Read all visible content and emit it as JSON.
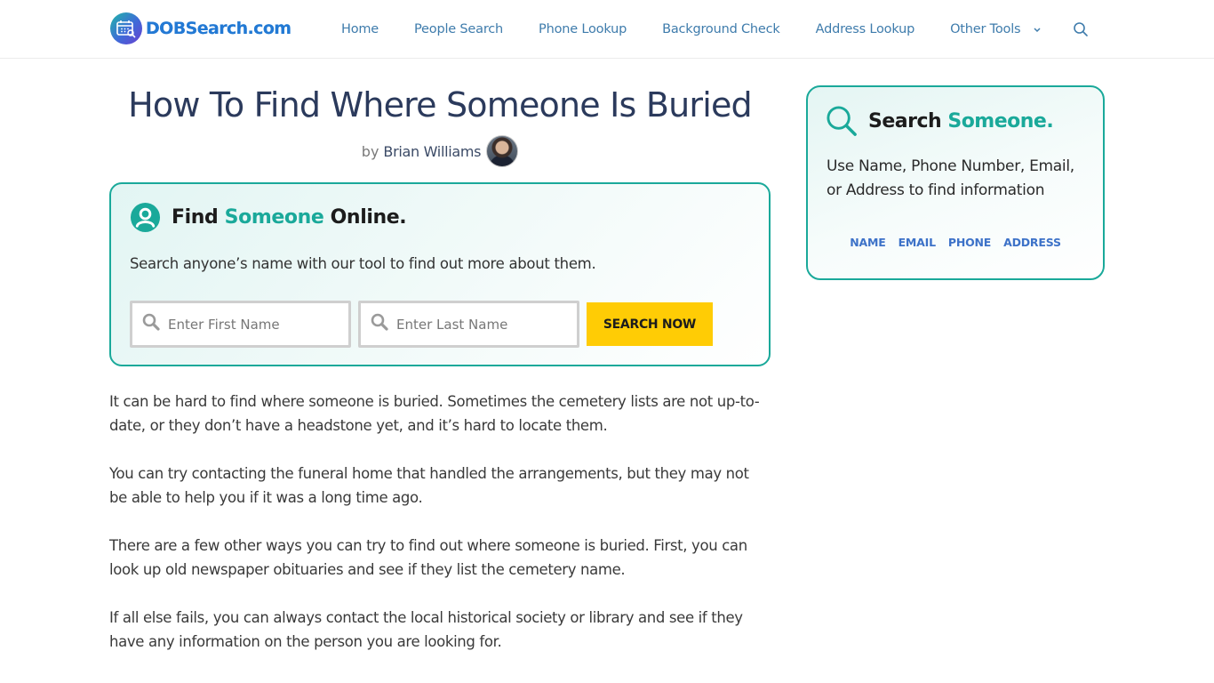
{
  "header": {
    "logo_text": "DOBSearch.com",
    "nav": [
      {
        "label": "Home"
      },
      {
        "label": "People Search"
      },
      {
        "label": "Phone Lookup"
      },
      {
        "label": "Background Check"
      },
      {
        "label": "Address Lookup"
      },
      {
        "label": "Other Tools",
        "has_dropdown": true
      }
    ],
    "search_icon": "search-icon"
  },
  "article": {
    "title": "How To Find Where Someone Is Buried",
    "byline_prefix": "by",
    "author": "Brian Williams",
    "paragraphs": [
      "It can be hard to find where someone is buried. Sometimes the cemetery lists are not up-to-date, or they don’t have a headstone yet, and it’s hard to locate them.",
      "You can try contacting the funeral home that handled the arrangements, but they may not be able to help you if it was a long time ago.",
      "There are a few other ways you can try to find out where someone is buried. First, you can look up old newspaper obituaries and see if they list the cemetery name.",
      "If all else fails, you can always contact the local historical society or library and see if they have any information on the person you are looking for."
    ]
  },
  "find_box": {
    "icon": "user-circle-icon",
    "title_pre": "Find",
    "title_accent": "Someone",
    "title_post": "Online.",
    "description": "Search anyone’s name with our tool to find out more about them.",
    "first_name": {
      "placeholder": "Enter First Name",
      "value": ""
    },
    "last_name": {
      "placeholder": "Enter Last Name",
      "value": ""
    },
    "button_label": "SEARCH NOW"
  },
  "sidebar": {
    "icon": "search-icon",
    "title_pre": "Search",
    "title_accent": "Someone.",
    "description": "Use Name, Phone Number, Email, or Address to find information",
    "links": [
      {
        "label": "NAME"
      },
      {
        "label": "EMAIL"
      },
      {
        "label": "PHONE"
      },
      {
        "label": "ADDRESS"
      }
    ]
  },
  "colors": {
    "accent": "#1aa99a",
    "nav_link": "#3f7cac",
    "title": "#2b3a5c",
    "button": "#ffcc05",
    "sidebar_link": "#3d72c8"
  }
}
